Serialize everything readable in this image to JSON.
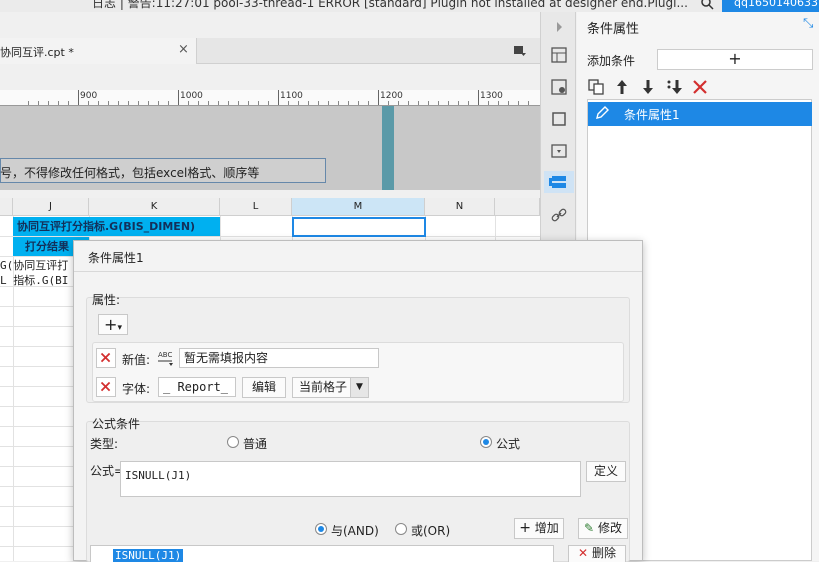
{
  "topbar": {
    "log_text": "日志 | 警告:11:27:01 pool-33-thread-1 ERROR [standard] Plugin not installed at designer end.Plugi...",
    "user": "qq1650140633"
  },
  "file_tab": {
    "label": "协同互评.cpt *",
    "close": "×"
  },
  "ruler": {
    "labels": [
      "900",
      "1000",
      "1100",
      "1200",
      "1300"
    ]
  },
  "design": {
    "note": "号，不得修改任何格式，包括excel格式、顺序等"
  },
  "grid": {
    "columns": [
      "J",
      "K",
      "L",
      "M",
      "N"
    ],
    "cells": {
      "row1": "协同互评打分指标.G(BIS_DIMEN)",
      "row2": "打分结果",
      "row3a": "G(协同互评打",
      "row3b": "L  指标.G(BI"
    }
  },
  "property_panel": {
    "title": "条件属性",
    "add_label": "添加条件",
    "add_button": "+",
    "list": [
      "条件属性1"
    ]
  },
  "dialog": {
    "title": "条件属性1",
    "attr_group_label": "属性:",
    "add_attr": "+",
    "new_value_label": "新值:",
    "new_value": "暂无需填报内容",
    "font_label": "字体:",
    "font_value": "_ Report_",
    "edit_button": "编辑",
    "scope_value": "当前格子",
    "formula_group_label": "公式条件",
    "type_label": "类型:",
    "type_options": [
      "普通",
      "公式"
    ],
    "type_selected": "公式",
    "formula_label": "公式=",
    "formula_value": "ISNULL(J1)",
    "define_button": "定义",
    "logic_options": [
      "与(AND)",
      "或(OR)"
    ],
    "logic_selected": "与(AND)",
    "add_button": "增加",
    "modify_button": "修改",
    "list_item": "ISNULL(J1)",
    "delete_button": "删除"
  },
  "colors": {
    "accent": "#1e88e5",
    "cyan_cell": "#00b0f0",
    "danger": "#d32f2f"
  }
}
